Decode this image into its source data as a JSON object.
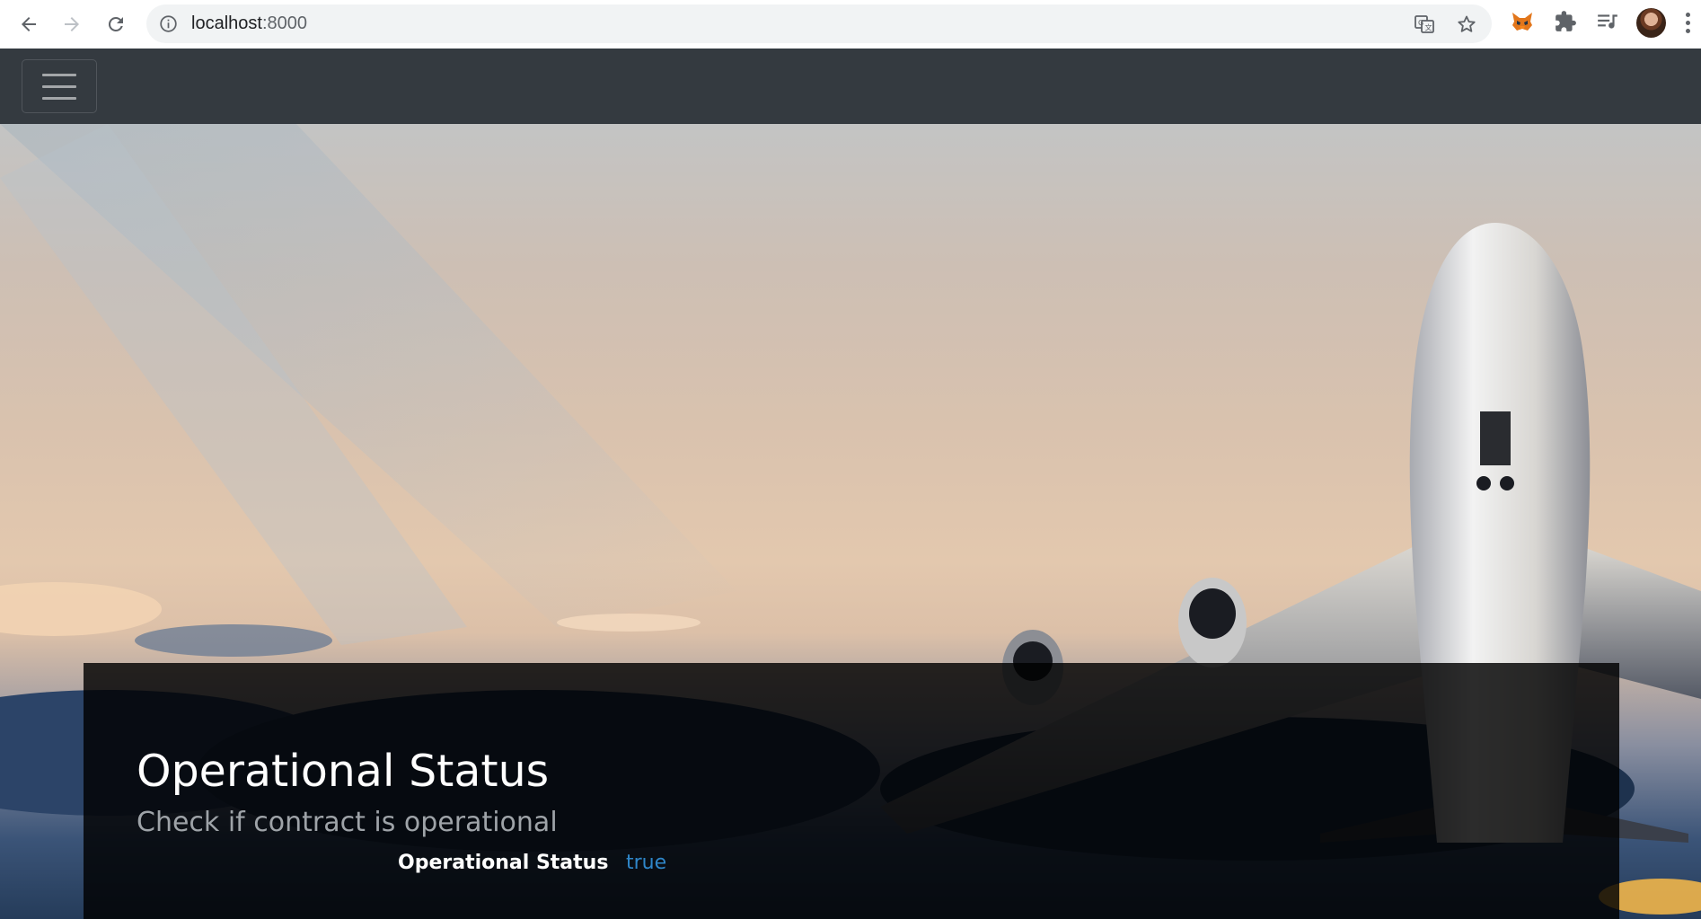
{
  "browser": {
    "url_host": "localhost",
    "url_port": ":8000",
    "icons": [
      "back-icon",
      "forward-icon",
      "reload-icon",
      "info-icon",
      "translate-icon",
      "star-icon",
      "metamask-fox-icon",
      "extensions-puzzle-icon",
      "reading-list-icon",
      "profile-avatar",
      "kebab-menu-icon"
    ]
  },
  "navbar": {
    "background": "#343a40",
    "toggler_icon": "hamburger-icon"
  },
  "hero": {
    "image": "airplane-takeoff-sunset",
    "panel": {
      "title": "Operational Status",
      "subtitle": "Check if contract is operational",
      "status_label": "Operational Status",
      "status_value": "true",
      "status_value_color": "#2f86c9"
    }
  }
}
